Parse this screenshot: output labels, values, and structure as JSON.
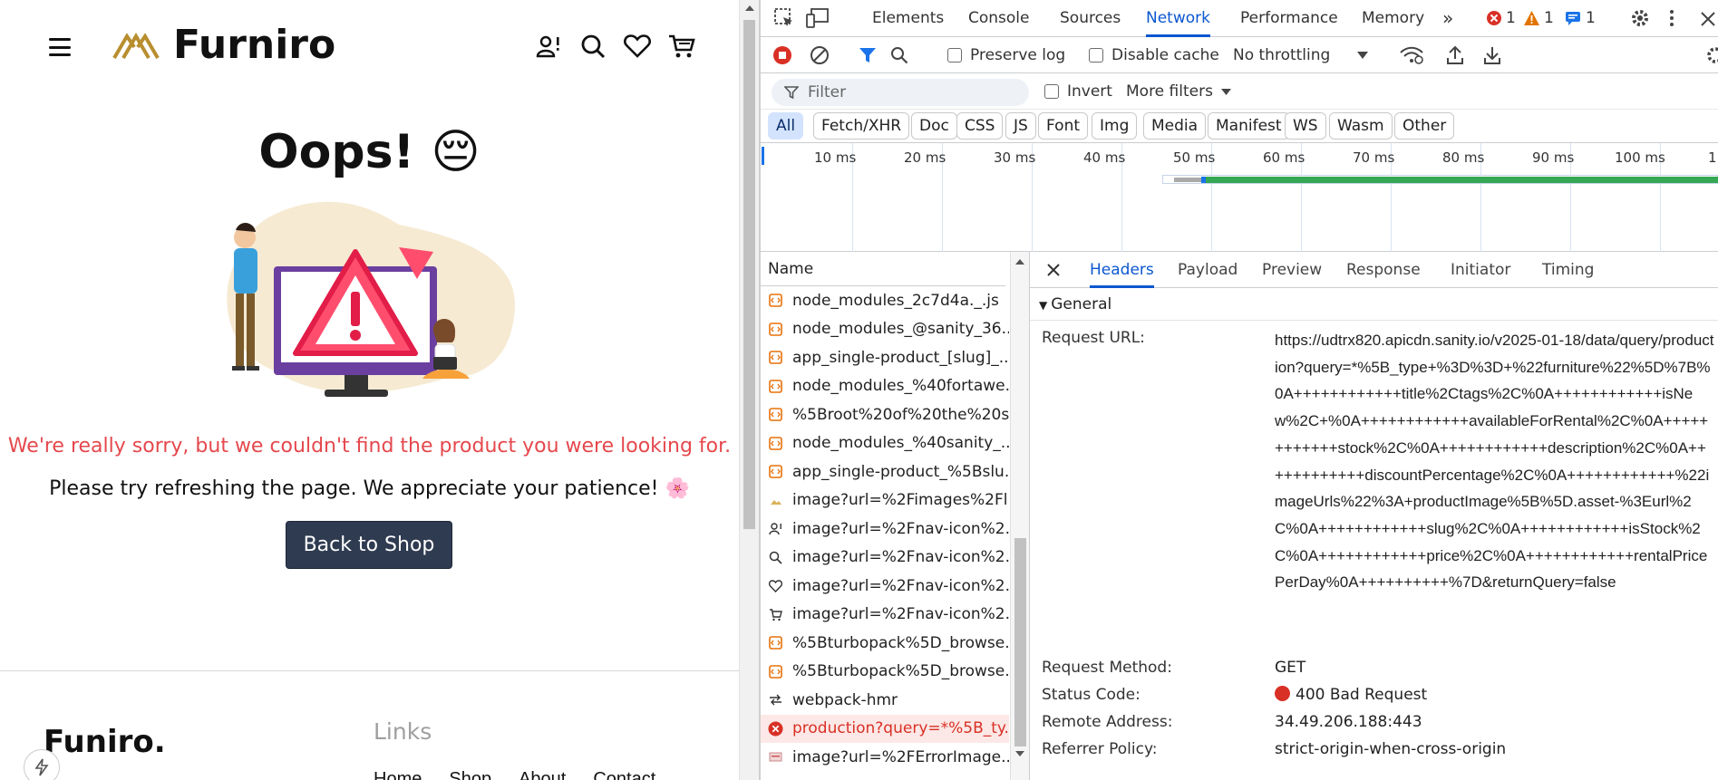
{
  "site": {
    "brand": "Furniro",
    "heading": "Oops! 😔",
    "sorry_text": "We're really sorry, but we couldn't find the product you were looking for.",
    "please_text": "Please try refreshing the page. We appreciate your patience! 🌸",
    "back_button": "Back to Shop",
    "footer_brand": "Funiro.",
    "footer_links_heading": "Links",
    "footer_links": [
      "Home",
      "Shop",
      "About",
      "Contact"
    ]
  },
  "devtools": {
    "tabs": [
      "Elements",
      "Console",
      "Sources",
      "Network",
      "Performance",
      "Memory"
    ],
    "active_tab": "Network",
    "error_count": "1",
    "warning_count": "1",
    "info_count": "1",
    "toolbar": {
      "preserve_log": "Preserve log",
      "disable_cache": "Disable cache",
      "throttling": "No throttling"
    },
    "filter": {
      "placeholder": "Filter",
      "invert": "Invert",
      "more_filters": "More filters"
    },
    "type_filters": [
      "All",
      "Fetch/XHR",
      "Doc",
      "CSS",
      "JS",
      "Font",
      "Img",
      "Media",
      "Manifest",
      "WS",
      "Wasm",
      "Other"
    ],
    "timeline_labels": [
      "10 ms",
      "20 ms",
      "30 ms",
      "40 ms",
      "50 ms",
      "60 ms",
      "70 ms",
      "80 ms",
      "90 ms",
      "100 ms",
      "1"
    ],
    "request_column": "Name",
    "requests": [
      {
        "name": "node_modules_2c7d4a._.js",
        "icon": "script-icon"
      },
      {
        "name": "node_modules_@sanity_36...",
        "icon": "script-icon"
      },
      {
        "name": "app_single-product_[slug]_...",
        "icon": "script-icon"
      },
      {
        "name": "node_modules_%40fortawe...",
        "icon": "script-icon"
      },
      {
        "name": "%5Broot%20of%20the%20s...",
        "icon": "script-icon"
      },
      {
        "name": "node_modules_%40sanity_...",
        "icon": "script-icon"
      },
      {
        "name": "app_single-product_%5Bslu...",
        "icon": "script-icon"
      },
      {
        "name": "image?url=%2Fimages%2Fl...",
        "icon": "image-icon"
      },
      {
        "name": "image?url=%2Fnav-icon%2...",
        "icon": "user-icon"
      },
      {
        "name": "image?url=%2Fnav-icon%2...",
        "icon": "search-icon"
      },
      {
        "name": "image?url=%2Fnav-icon%2...",
        "icon": "heart-icon"
      },
      {
        "name": "image?url=%2Fnav-icon%2...",
        "icon": "cart-icon"
      },
      {
        "name": "%5Bturbopack%5D_browse...",
        "icon": "script-icon"
      },
      {
        "name": "%5Bturbopack%5D_browse...",
        "icon": "script-icon"
      },
      {
        "name": "webpack-hmr",
        "icon": "websocket-icon"
      },
      {
        "name": "production?query=*%5B_ty...",
        "icon": "error-icon",
        "error": true
      },
      {
        "name": "image?url=%2FErrorImage...",
        "icon": "image-icon"
      }
    ],
    "detail_tabs": [
      "Headers",
      "Payload",
      "Preview",
      "Response",
      "Initiator",
      "Timing"
    ],
    "active_detail_tab": "Headers",
    "general_section": "General",
    "general": {
      "request_url_label": "Request URL:",
      "request_url": "https://udtrx820.apicdn.sanity.io/v2025-01-18/data/query/production?query=*%5B_type+%3D%3D+%22furniture%22%5D%7B%0A++++++++++++title%2Ctags%2C%0A++++++++++++isNew%2C+%0A++++++++++++availableForRental%2C%0A++++++++++++stock%2C%0A++++++++++++description%2C%0A++++++++++++discountPercentage%2C%0A++++++++++++%22imageUrls%22%3A+productImage%5B%5D.asset-%3Eurl%2C%0A++++++++++++slug%2C%0A++++++++++++isStock%2C%0A++++++++++++price%2C%0A++++++++++++rentalPricePerDay%0A++++++++++%7D&returnQuery=false",
      "request_method_label": "Request Method:",
      "request_method": "GET",
      "status_code_label": "Status Code:",
      "status_code": "400 Bad Request",
      "remote_address_label": "Remote Address:",
      "remote_address": "34.49.206.188:443",
      "referrer_policy_label": "Referrer Policy:",
      "referrer_policy": "strict-origin-when-cross-origin"
    },
    "colors": {
      "accent": "#0b57d0",
      "error": "#d93025",
      "warning": "#e37400",
      "brand_gold": "#b88e2f",
      "button_bg": "#2f3b50"
    }
  }
}
